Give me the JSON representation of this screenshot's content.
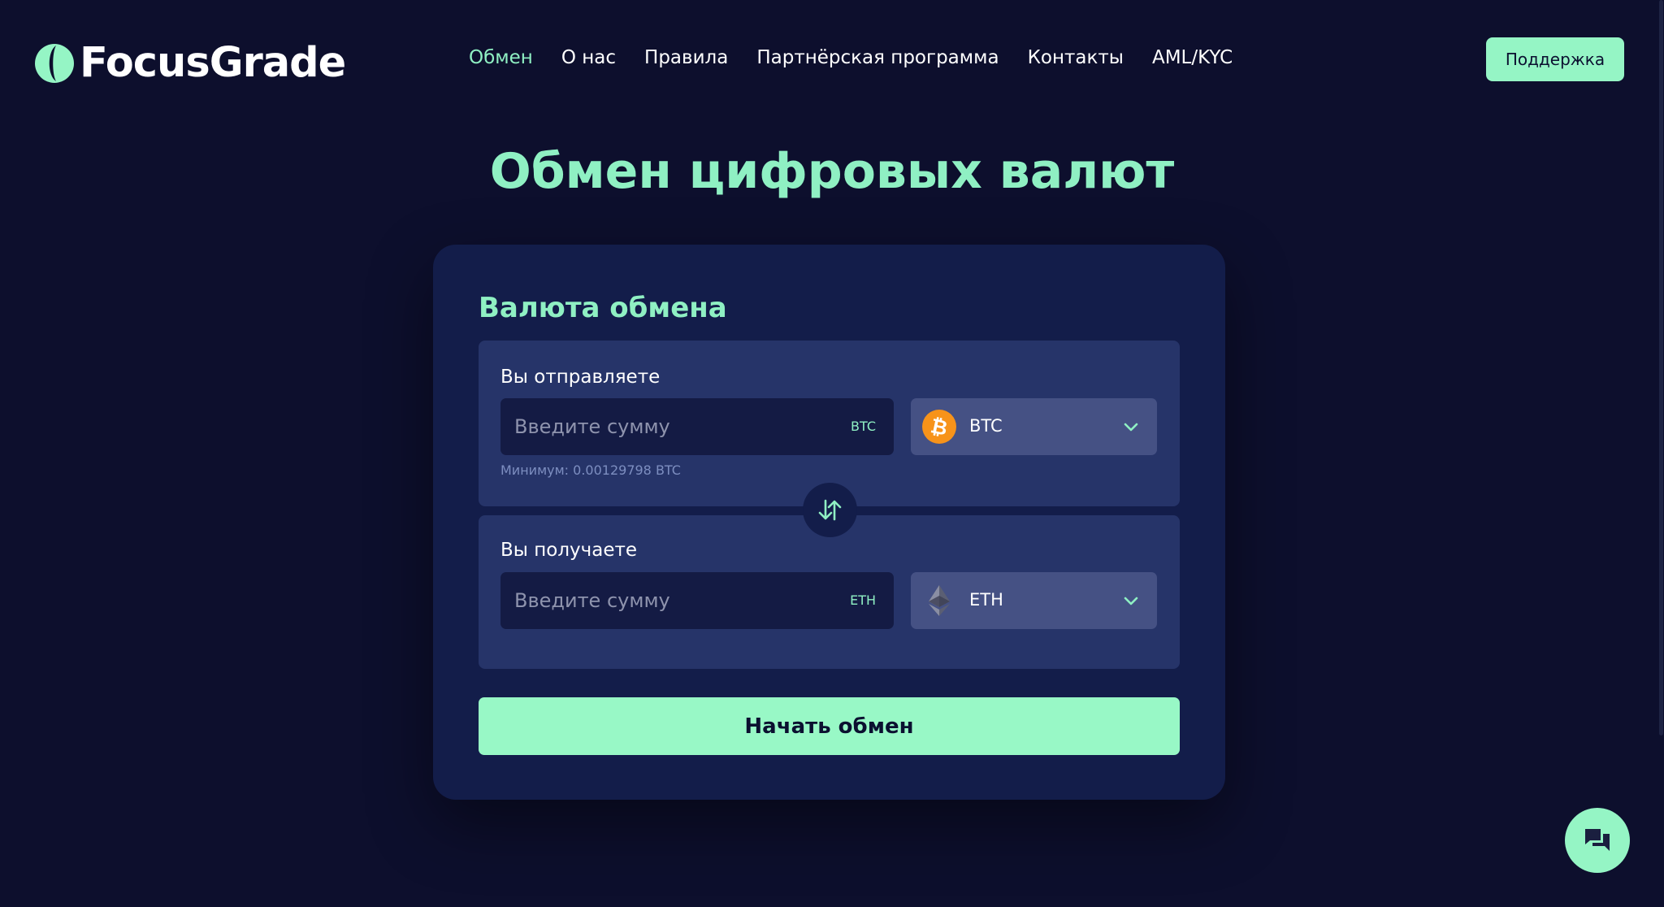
{
  "header": {
    "logo_text": "FocusGrade",
    "nav": [
      {
        "label": "Обмен",
        "active": true
      },
      {
        "label": "О нас",
        "active": false
      },
      {
        "label": "Правила",
        "active": false
      },
      {
        "label": "Партнёрская программа",
        "active": false
      },
      {
        "label": "Контакты",
        "active": false
      },
      {
        "label": "AML/KYC",
        "active": false
      }
    ],
    "support_label": "Поддержка"
  },
  "title": "Обмен цифровых валют",
  "exchange": {
    "heading": "Валюта обмена",
    "send": {
      "label": "Вы отправляете",
      "placeholder": "Введите сумму",
      "value": "",
      "unit": "BTC",
      "currency": "BTC",
      "currency_icon": "bitcoin-icon",
      "minimum": "Минимум: 0.00129798 BTC"
    },
    "receive": {
      "label": "Вы получаете",
      "placeholder": "Введите сумму",
      "value": "",
      "unit": "ETH",
      "currency": "ETH",
      "currency_icon": "ethereum-icon"
    },
    "swap_icon": "swap-arrows-icon",
    "start_label": "Начать обмен"
  },
  "chat_icon": "chat-icon",
  "colors": {
    "background": "#0d0f2d",
    "card": "#131d4a",
    "panel": "#263469",
    "accent": "#95f5c5",
    "bitcoin": "#f7931a"
  }
}
